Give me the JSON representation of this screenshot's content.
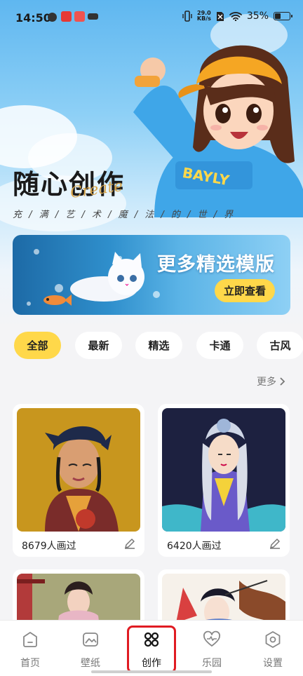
{
  "status_bar": {
    "time": "14:50",
    "net_speed": "29.0",
    "net_unit": "KB/s",
    "battery": "35%"
  },
  "hero": {
    "title": "随心创作",
    "script": "Create",
    "subtitle": "充 / 满 / 艺 / 术 / 魔 / 法 / 的 / 世 / 界"
  },
  "banner": {
    "title": "更多精选模版",
    "button": "立即查看"
  },
  "categories": [
    {
      "label": "全部",
      "active": true
    },
    {
      "label": "最新",
      "active": false
    },
    {
      "label": "精选",
      "active": false
    },
    {
      "label": "卡通",
      "active": false
    },
    {
      "label": "古风",
      "active": false
    }
  ],
  "more_label": "更多",
  "cards": [
    {
      "count": "8679人画过"
    },
    {
      "count": "6420人画过"
    }
  ],
  "nav": [
    {
      "label": "首页",
      "icon": "home-icon"
    },
    {
      "label": "壁纸",
      "icon": "wallpaper-icon"
    },
    {
      "label": "创作",
      "icon": "create-grid-icon"
    },
    {
      "label": "乐园",
      "icon": "heart-pulse-icon"
    },
    {
      "label": "设置",
      "icon": "settings-hex-icon"
    }
  ],
  "colors": {
    "accent": "#ffd84a",
    "highlight": "#e01b22",
    "text": "#222222"
  }
}
